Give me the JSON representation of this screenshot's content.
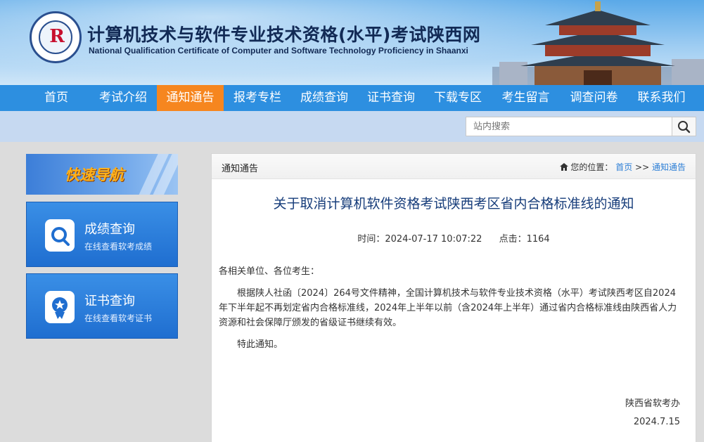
{
  "header": {
    "title": "计算机技术与软件专业技术资格(水平)考试陕西网",
    "subtitle": "National Qualification Certificate of Computer and Software Technology Proficiency in Shaanxi",
    "logo_icon": "circular-seal-logo-icon"
  },
  "nav": {
    "items": [
      {
        "label": "首页"
      },
      {
        "label": "考试介绍"
      },
      {
        "label": "通知通告",
        "active": true
      },
      {
        "label": "报考专栏"
      },
      {
        "label": "成绩查询"
      },
      {
        "label": "证书查询"
      },
      {
        "label": "下载专区"
      },
      {
        "label": "考生留言"
      },
      {
        "label": "调查问卷"
      },
      {
        "label": "联系我们"
      }
    ],
    "active_color": "#f6861f",
    "bar_color": "#2d8fe0"
  },
  "search": {
    "placeholder": "站内搜索",
    "button_icon": "search-icon"
  },
  "sidebar": {
    "quick_nav_label": "快速导航",
    "cards": [
      {
        "title": "成绩查询",
        "subtitle": "在线查看软考成绩",
        "icon": "magnifier-document-icon"
      },
      {
        "title": "证书查询",
        "subtitle": "在线查看软考证书",
        "icon": "certificate-badge-icon"
      }
    ]
  },
  "main": {
    "section_label": "通知通告",
    "breadcrumb": {
      "prefix": "您的位置：",
      "home": "首页",
      "separator": ">>",
      "current": "通知通告",
      "icon": "home-icon"
    },
    "article": {
      "title": "关于取消计算机软件资格考试陕西考区省内合格标准线的通知",
      "time_label": "时间：2024-07-17 10:07:22",
      "clicks_label": "点击：1164",
      "greeting": "各相关单位、各位考生：",
      "paragraph": "根据陕人社函〔2024〕264号文件精神，全国计算机技术与软件专业技术资格（水平）考试陕西考区自2024年下半年起不再划定省内合格标准线，2024年上半年以前（含2024年上半年）通过省内合格标准线由陕西省人力资源和社会保障厅颁发的省级证书继续有效。",
      "closing": "特此通知。",
      "signature": "陕西省软考办",
      "date": "2024.7.15"
    }
  }
}
